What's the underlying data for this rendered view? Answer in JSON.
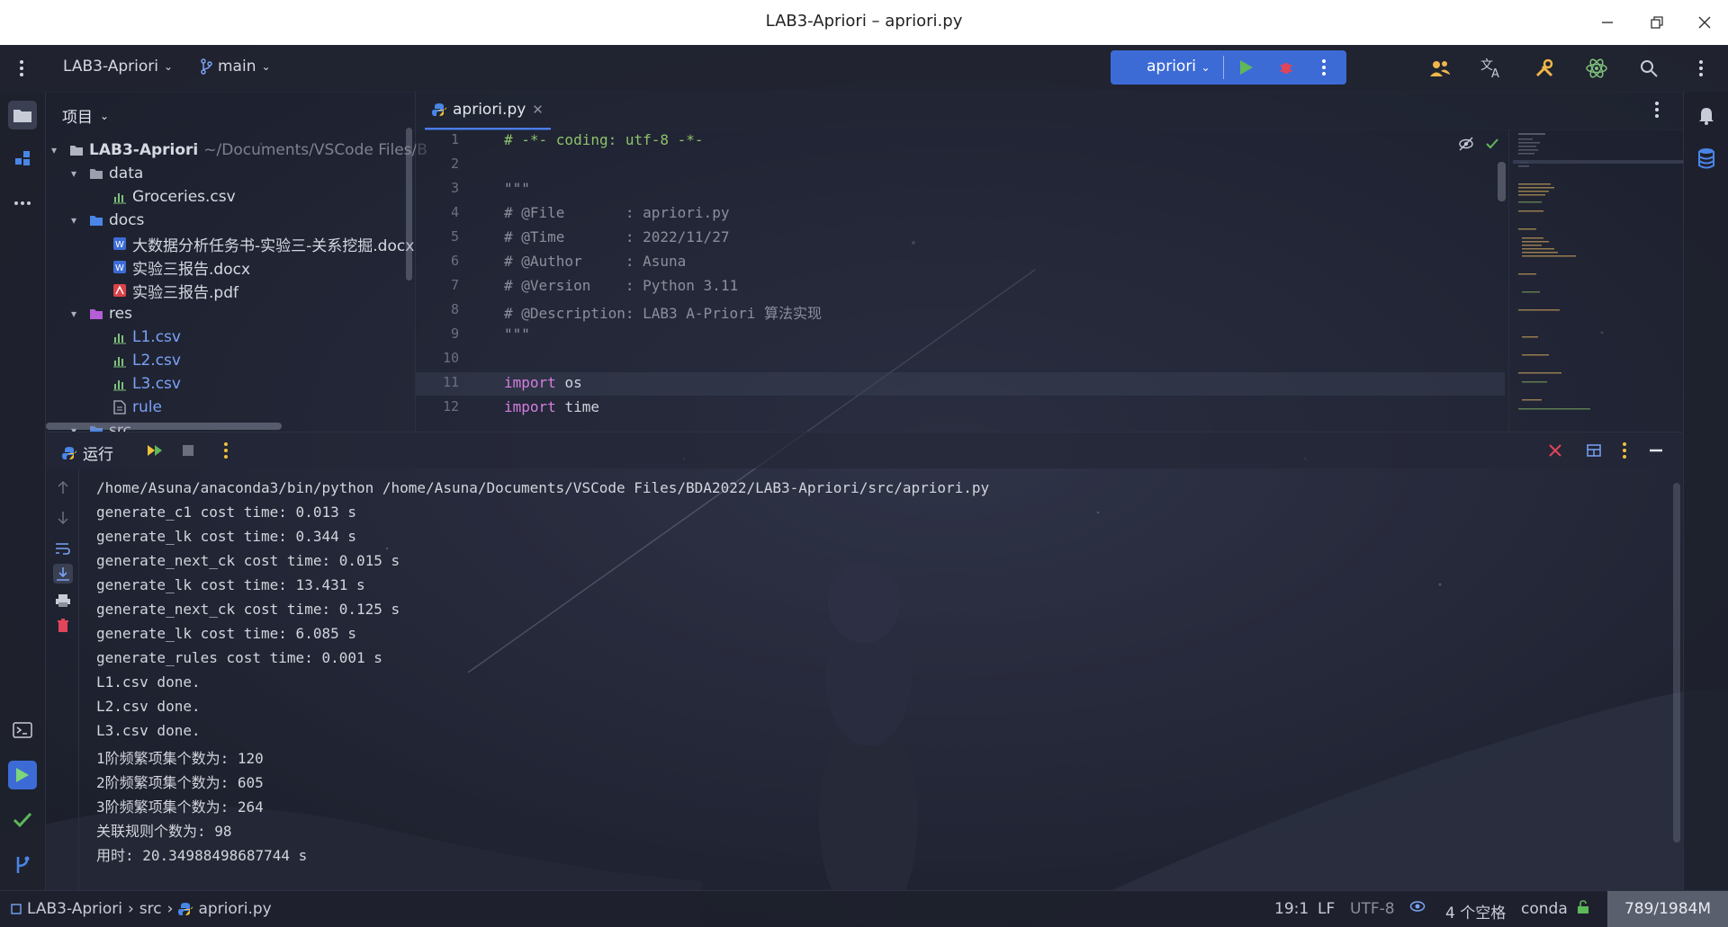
{
  "window": {
    "title": "LAB3-Apriori – apriori.py"
  },
  "toolbar": {
    "project_name": "LAB3-Apriori",
    "branch": "main",
    "run_config": "apriori"
  },
  "project_panel": {
    "header": "项目",
    "root": {
      "name": "LAB3-Apriori",
      "path": "~/Documents/VSCode Files/B"
    },
    "items": [
      {
        "label": "data"
      },
      {
        "label": "Groceries.csv"
      },
      {
        "label": "docs"
      },
      {
        "label": "大数据分析任务书-实验三-关系挖掘.docx"
      },
      {
        "label": "实验三报告.docx"
      },
      {
        "label": "实验三报告.pdf"
      },
      {
        "label": "res"
      },
      {
        "label": "L1.csv"
      },
      {
        "label": "L2.csv"
      },
      {
        "label": "L3.csv"
      },
      {
        "label": "rule"
      },
      {
        "label": "src"
      }
    ]
  },
  "editor": {
    "tab_label": "apriori.py",
    "line_numbers": [
      "1",
      "2",
      "3",
      "4",
      "5",
      "6",
      "7",
      "8",
      "9",
      "10",
      "11",
      "12"
    ],
    "lines": [
      "# -*- coding: utf-8 -*-",
      "",
      "\"\"\"",
      "# @File       : apriori.py",
      "# @Time       : 2022/11/27",
      "# @Author     : Asuna",
      "# @Version    : Python 3.11",
      "# @Description: LAB3 A-Priori 算法实现",
      "\"\"\"",
      "",
      "import",
      "import"
    ],
    "line11_module": "os",
    "line12_module": "time"
  },
  "run_panel": {
    "title": "运行",
    "output": [
      "/home/Asuna/anaconda3/bin/python /home/Asuna/Documents/VSCode Files/BDA2022/LAB3-Apriori/src/apriori.py",
      "generate_c1 cost time: 0.013 s",
      "generate_lk cost time: 0.344 s",
      "generate_next_ck cost time: 0.015 s",
      "generate_lk cost time: 13.431 s",
      "generate_next_ck cost time: 0.125 s",
      "generate_lk cost time: 6.085 s",
      "generate_rules cost time: 0.001 s",
      "L1.csv done.",
      "L2.csv done.",
      "L3.csv done.",
      "1阶频繁项集个数为: 120",
      "2阶频繁项集个数为: 605",
      "3阶频繁项集个数为: 264",
      "关联规则个数为: 98",
      "用时: 20.34988498687744 s"
    ]
  },
  "statusbar": {
    "crumb_project": "LAB3-Apriori",
    "crumb_folder": "src",
    "crumb_file": "apriori.py",
    "position": "19:1",
    "line_sep": "LF",
    "encoding": "UTF-8",
    "indent": "4 个空格",
    "interpreter": "conda",
    "memory": "789/1984M"
  },
  "colors": {
    "accent": "#3d6bd6",
    "run_green": "#5fb85a",
    "stop_red": "#e0455a"
  }
}
